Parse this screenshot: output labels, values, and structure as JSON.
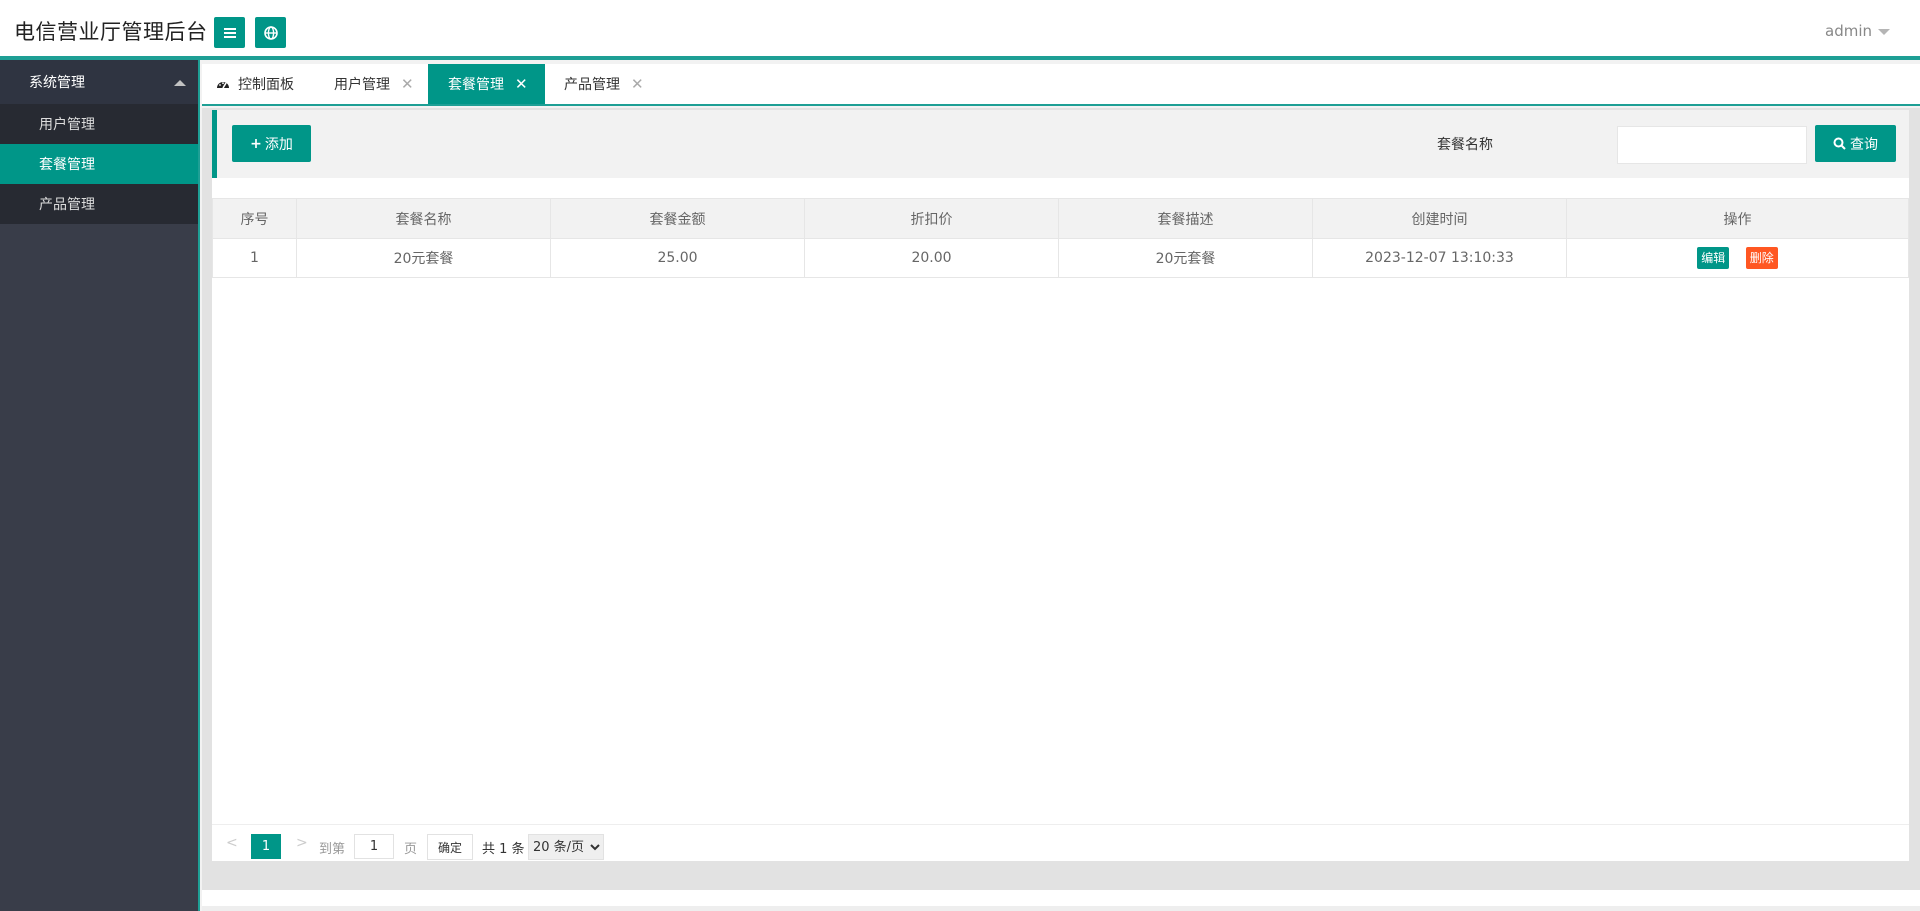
{
  "header": {
    "title": "电信营业厅管理后台",
    "menu_icon": "menu-icon",
    "globe_icon": "globe-icon",
    "user": "admin"
  },
  "sidebar": {
    "group": "系统管理",
    "items": [
      {
        "label": "用户管理",
        "active": false
      },
      {
        "label": "套餐管理",
        "active": true
      },
      {
        "label": "产品管理",
        "active": false
      }
    ]
  },
  "tabs": [
    {
      "label": "控制面板",
      "icon": "dashboard-icon",
      "closable": false,
      "active": false
    },
    {
      "label": "用户管理",
      "closable": true,
      "active": false
    },
    {
      "label": "套餐管理",
      "closable": true,
      "active": true
    },
    {
      "label": "产品管理",
      "closable": true,
      "active": false
    }
  ],
  "toolbar": {
    "add_label": "添加",
    "search_label": "套餐名称",
    "search_value": "",
    "query_label": "查询"
  },
  "table": {
    "columns": [
      "序号",
      "套餐名称",
      "套餐金额",
      "折扣价",
      "套餐描述",
      "创建时间",
      "操作"
    ],
    "rows": [
      {
        "index": "1",
        "name": "20元套餐",
        "amount": "25.00",
        "discount": "20.00",
        "desc": "20元套餐",
        "created": "2023-12-07 13:10:33",
        "edit_label": "编辑",
        "delete_label": "删除"
      }
    ]
  },
  "pager": {
    "current": "1",
    "goto_label": "到第",
    "goto_value": "1",
    "page_unit": "页",
    "confirm_label": "确定",
    "total": "共 1 条",
    "page_size": "20 条/页"
  },
  "colors": {
    "accent": "#009688",
    "danger": "#ff5722",
    "sidebar_bg": "#393d49"
  }
}
